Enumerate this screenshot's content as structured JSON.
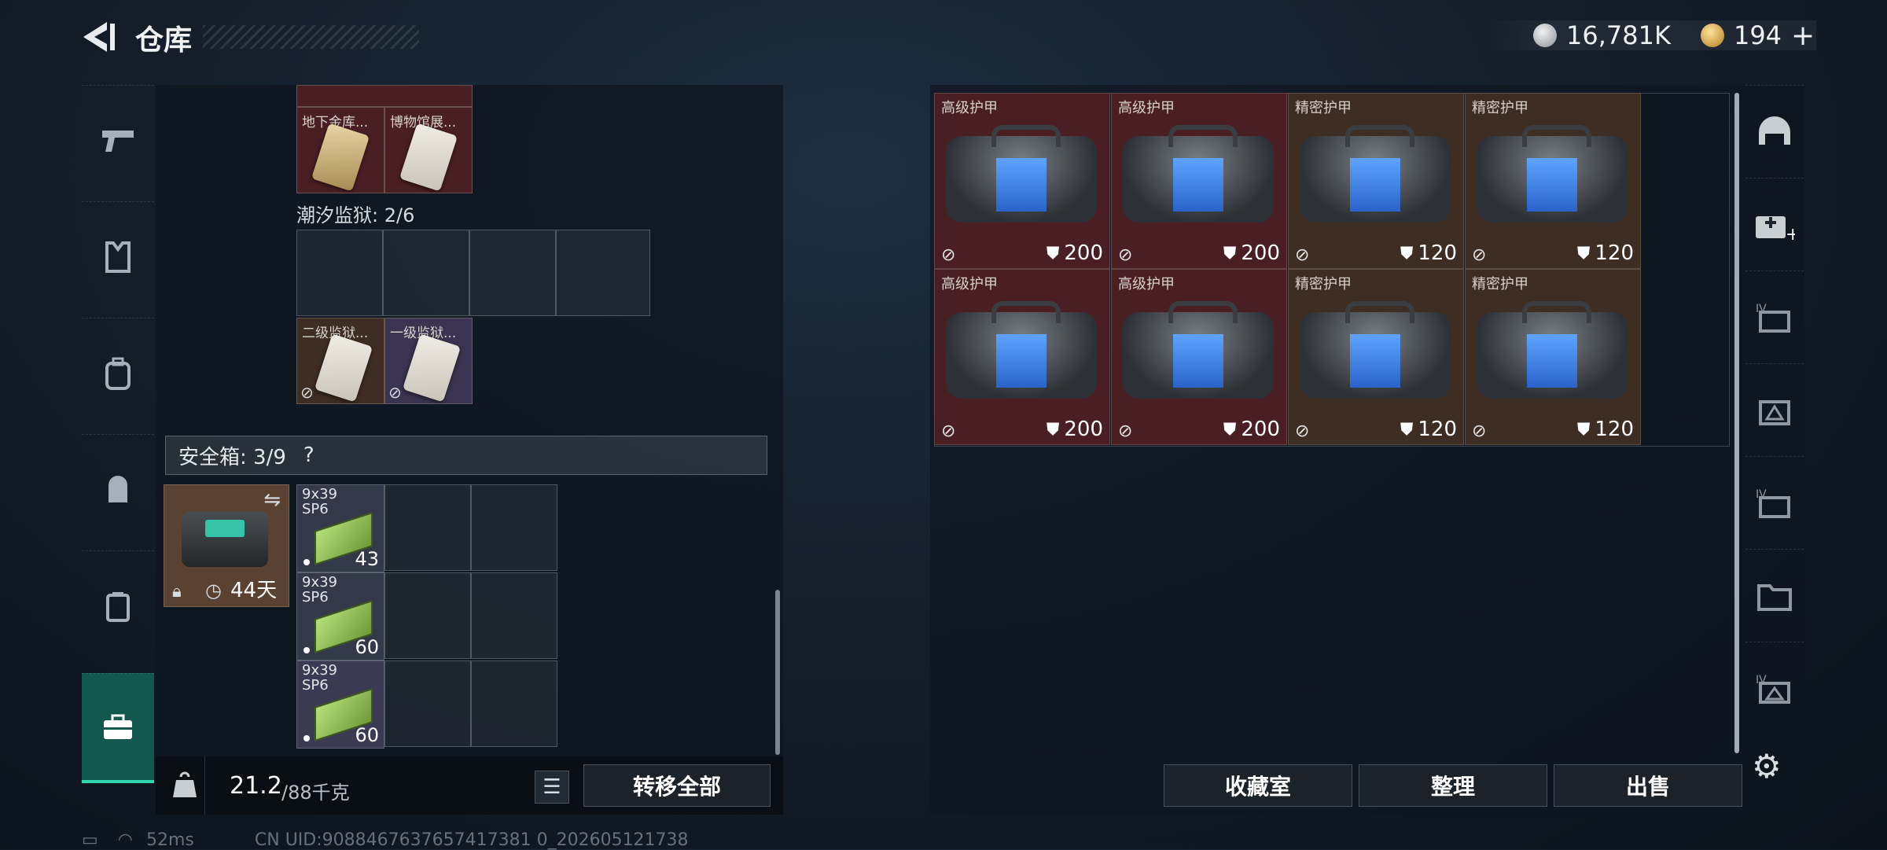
{
  "header": {
    "title": "仓库",
    "currency_silver": "16,781K",
    "currency_gold": "194",
    "add_symbol": "+"
  },
  "left_nav": {
    "items": [
      {
        "name": "nav-weapons",
        "icon": "pistol-icon",
        "glyph": "⌐"
      },
      {
        "name": "nav-armor",
        "icon": "vest-icon",
        "glyph": "▣"
      },
      {
        "name": "nav-backpack",
        "icon": "backpack-icon",
        "glyph": "◘"
      },
      {
        "name": "nav-bag",
        "icon": "pouch-icon",
        "glyph": "◙"
      },
      {
        "name": "nav-case",
        "icon": "case-icon",
        "glyph": "▤"
      },
      {
        "name": "nav-safebox",
        "icon": "toolbox-icon",
        "glyph": "▦"
      }
    ]
  },
  "keycards": {
    "top_items": [
      {
        "name": "地下金库...",
        "color": "red"
      },
      {
        "name": "博物馆展...",
        "color": "red"
      }
    ],
    "prison_label": "潮汐监狱: 2/6",
    "prison_items": [
      {
        "name": "二级监狱...",
        "color": "brown"
      },
      {
        "name": "一级监狱...",
        "color": "purple"
      }
    ]
  },
  "safebox": {
    "label": "安全箱: 3/9",
    "help": "?",
    "timer": "44天",
    "ammo": [
      {
        "name_line1": "9x39",
        "name_line2": "SP6",
        "count": "43"
      },
      {
        "name_line1": "9x39",
        "name_line2": "SP6",
        "count": "60"
      },
      {
        "name_line1": "9x39",
        "name_line2": "SP6",
        "count": "60"
      }
    ]
  },
  "bottom_left": {
    "weight_current": "21.2",
    "weight_max": "/88千克",
    "transfer_all": "转移全部"
  },
  "armor_grid": [
    {
      "name": "高级护甲",
      "durability": "200",
      "tier": "red"
    },
    {
      "name": "高级护甲",
      "durability": "200",
      "tier": "red"
    },
    {
      "name": "精密护甲",
      "durability": "120",
      "tier": "brown"
    },
    {
      "name": "精密护甲",
      "durability": "120",
      "tier": "brown"
    },
    {
      "name": "高级护甲",
      "durability": "200",
      "tier": "red"
    },
    {
      "name": "高级护甲",
      "durability": "200",
      "tier": "red"
    },
    {
      "name": "精密护甲",
      "durability": "120",
      "tier": "brown"
    },
    {
      "name": "精密护甲",
      "durability": "120",
      "tier": "brown"
    }
  ],
  "bottom_right": {
    "collection": "收藏室",
    "sort": "整理",
    "sell": "出售"
  },
  "right_nav": {
    "items": [
      {
        "name": "rnav-helmet",
        "icon": "helmet-icon",
        "glyph": "⌒"
      },
      {
        "name": "rnav-medkit-add",
        "icon": "medkit-add-icon",
        "glyph": "✚"
      },
      {
        "name": "rnav-tier4-a",
        "icon": "tier4-box-icon",
        "glyph": "▥"
      },
      {
        "name": "rnav-tier4-b",
        "icon": "tier-box-icon",
        "glyph": "◭"
      },
      {
        "name": "rnav-tier4-c",
        "icon": "tier4-box-icon",
        "glyph": "▥"
      },
      {
        "name": "rnav-folder",
        "icon": "folder-icon",
        "glyph": "▭"
      },
      {
        "name": "rnav-tier4-d",
        "icon": "tier4-box-icon",
        "glyph": "◭"
      }
    ]
  },
  "status": {
    "ping": "52ms",
    "uid": "CN UID:9088467637657417381 0_202605121738"
  },
  "colors": {
    "accent": "#32d6ae",
    "red_tier": "#4a1f23",
    "brown_tier": "#3e2d22"
  }
}
